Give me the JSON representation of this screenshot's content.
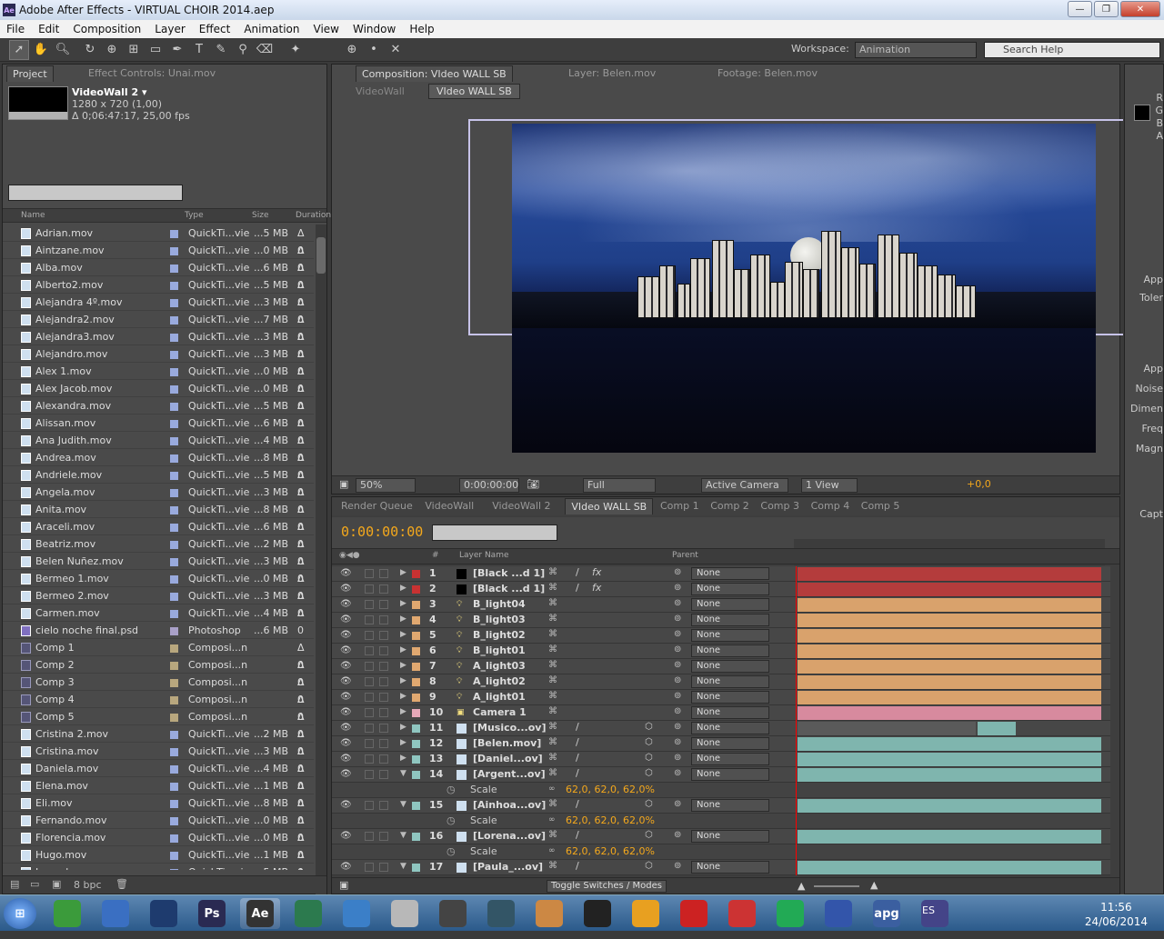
{
  "window": {
    "title": "Adobe After Effects - VIRTUAL CHOIR 2014.aep",
    "app_icon": "Ae"
  },
  "menu": [
    "File",
    "Edit",
    "Composition",
    "Layer",
    "Effect",
    "Animation",
    "View",
    "Window",
    "Help"
  ],
  "toolbar": {
    "workspace_label": "Workspace:",
    "workspace_value": "Animation",
    "search_placeholder": "Search Help"
  },
  "project_panel": {
    "tabs": [
      "Project",
      "Effect Controls: Unai.mov"
    ],
    "comp_name": "VideoWall 2 ▾",
    "comp_res": "1280 x 720 (1,00)",
    "comp_dur": "Δ 0;06:47:17, 25,00 fps",
    "columns": {
      "name": "Name",
      "type": "Type",
      "size": "Size",
      "duration": "Duration"
    },
    "bpc": "8 bpc",
    "files": [
      {
        "name": "Adrian.mov",
        "type": "QuickTi...vie",
        "size": "...5 MB",
        "dur": "Δ 0",
        "kind": "mov"
      },
      {
        "name": "Aintzane.mov",
        "type": "QuickTi...vie",
        "size": "...0 MB",
        "dur": "Δ 0",
        "kind": "mov"
      },
      {
        "name": "Alba.mov",
        "type": "QuickTi...vie",
        "size": "...6 MB",
        "dur": "Δ 0",
        "kind": "mov"
      },
      {
        "name": "Alberto2.mov",
        "type": "QuickTi...vie",
        "size": "...5 MB",
        "dur": "Δ 0",
        "kind": "mov"
      },
      {
        "name": "Alejandra 4º.mov",
        "type": "QuickTi...vie",
        "size": "...3 MB",
        "dur": "Δ 0",
        "kind": "mov"
      },
      {
        "name": "Alejandra2.mov",
        "type": "QuickTi...vie",
        "size": "...7 MB",
        "dur": "Δ 0",
        "kind": "mov"
      },
      {
        "name": "Alejandra3.mov",
        "type": "QuickTi...vie",
        "size": "...3 MB",
        "dur": "Δ 0",
        "kind": "mov"
      },
      {
        "name": "Alejandro.mov",
        "type": "QuickTi...vie",
        "size": "...3 MB",
        "dur": "Δ 0",
        "kind": "mov"
      },
      {
        "name": "Alex 1.mov",
        "type": "QuickTi...vie",
        "size": "...0 MB",
        "dur": "Δ 0",
        "kind": "mov"
      },
      {
        "name": "Alex Jacob.mov",
        "type": "QuickTi...vie",
        "size": "...0 MB",
        "dur": "Δ 0",
        "kind": "mov"
      },
      {
        "name": "Alexandra.mov",
        "type": "QuickTi...vie",
        "size": "...5 MB",
        "dur": "Δ 0",
        "kind": "mov"
      },
      {
        "name": "Alissan.mov",
        "type": "QuickTi...vie",
        "size": "...6 MB",
        "dur": "Δ 0",
        "kind": "mov"
      },
      {
        "name": "Ana Judith.mov",
        "type": "QuickTi...vie",
        "size": "...4 MB",
        "dur": "Δ 0",
        "kind": "mov"
      },
      {
        "name": "Andrea.mov",
        "type": "QuickTi...vie",
        "size": "...8 MB",
        "dur": "Δ 0",
        "kind": "mov"
      },
      {
        "name": "Andriele.mov",
        "type": "QuickTi...vie",
        "size": "...5 MB",
        "dur": "Δ 0",
        "kind": "mov"
      },
      {
        "name": "Angela.mov",
        "type": "QuickTi...vie",
        "size": "...3 MB",
        "dur": "Δ 0",
        "kind": "mov"
      },
      {
        "name": "Anita.mov",
        "type": "QuickTi...vie",
        "size": "...8 MB",
        "dur": "Δ 0",
        "kind": "mov"
      },
      {
        "name": "Araceli.mov",
        "type": "QuickTi...vie",
        "size": "...6 MB",
        "dur": "Δ 0",
        "kind": "mov"
      },
      {
        "name": "Beatriz.mov",
        "type": "QuickTi...vie",
        "size": "...2 MB",
        "dur": "Δ 0",
        "kind": "mov"
      },
      {
        "name": "Belen Nuñez.mov",
        "type": "QuickTi...vie",
        "size": "...3 MB",
        "dur": "Δ 0",
        "kind": "mov"
      },
      {
        "name": "Bermeo 1.mov",
        "type": "QuickTi...vie",
        "size": "...0 MB",
        "dur": "Δ 0",
        "kind": "mov"
      },
      {
        "name": "Bermeo 2.mov",
        "type": "QuickTi...vie",
        "size": "...3 MB",
        "dur": "Δ 0",
        "kind": "mov"
      },
      {
        "name": "Carmen.mov",
        "type": "QuickTi...vie",
        "size": "...4 MB",
        "dur": "Δ 0",
        "kind": "mov"
      },
      {
        "name": "cielo noche final.psd",
        "type": "Photoshop",
        "size": "...6 MB",
        "dur": "",
        "kind": "ps"
      },
      {
        "name": "Comp 1",
        "type": "Composi...n",
        "size": "",
        "dur": "Δ 0",
        "kind": "cp"
      },
      {
        "name": "Comp 2",
        "type": "Composi...n",
        "size": "",
        "dur": "Δ 0",
        "kind": "cp"
      },
      {
        "name": "Comp 3",
        "type": "Composi...n",
        "size": "",
        "dur": "Δ 0",
        "kind": "cp"
      },
      {
        "name": "Comp 4",
        "type": "Composi...n",
        "size": "",
        "dur": "Δ 0",
        "kind": "cp"
      },
      {
        "name": "Comp 5",
        "type": "Composi...n",
        "size": "",
        "dur": "Δ 0",
        "kind": "cp"
      },
      {
        "name": "Cristina 2.mov",
        "type": "QuickTi...vie",
        "size": "...2 MB",
        "dur": "Δ 0",
        "kind": "mov"
      },
      {
        "name": "Cristina.mov",
        "type": "QuickTi...vie",
        "size": "...3 MB",
        "dur": "Δ 0",
        "kind": "mov"
      },
      {
        "name": "Daniela.mov",
        "type": "QuickTi...vie",
        "size": "...4 MB",
        "dur": "Δ 0",
        "kind": "mov"
      },
      {
        "name": "Elena.mov",
        "type": "QuickTi...vie",
        "size": "...1 MB",
        "dur": "Δ 0",
        "kind": "mov"
      },
      {
        "name": "Eli.mov",
        "type": "QuickTi...vie",
        "size": "...8 MB",
        "dur": "Δ 0",
        "kind": "mov"
      },
      {
        "name": "Fernando.mov",
        "type": "QuickTi...vie",
        "size": "...0 MB",
        "dur": "Δ 0",
        "kind": "mov"
      },
      {
        "name": "Florencia.mov",
        "type": "QuickTi...vie",
        "size": "...0 MB",
        "dur": "Δ 0",
        "kind": "mov"
      },
      {
        "name": "Hugo.mov",
        "type": "QuickTi...vie",
        "size": "...1 MB",
        "dur": "Δ 0",
        "kind": "mov"
      },
      {
        "name": "Ismael.mov",
        "type": "QuickTi...vie",
        "size": "...5 MB",
        "dur": "Δ 0",
        "kind": "mov"
      }
    ]
  },
  "comp_panel": {
    "tabs": [
      "Composition: VIdeo WALL SB",
      "Layer: Belen.mov",
      "Footage: Belen.mov"
    ],
    "breadcrumbs": [
      "VideoWall",
      "VIdeo WALL SB"
    ],
    "zoom": "50%",
    "timecode": "0:00:00:00",
    "resolution": "Full",
    "camera": "Active Camera",
    "views": "1 View",
    "exposure": "+0,0"
  },
  "timeline": {
    "tabs": [
      "Render Queue",
      "VideoWall",
      "VideoWall 2",
      "VIdeo WALL SB",
      "Comp 1",
      "Comp 2",
      "Comp 3",
      "Comp 4",
      "Comp 5"
    ],
    "active_tab": 3,
    "timecode": "0:00:00:00",
    "ruler": [
      "0m",
      "01m",
      "02m",
      "03m",
      "04m"
    ],
    "col_layer_name": "Layer Name",
    "col_num": "#",
    "col_parent": "Parent",
    "toggle_label": "Toggle Switches / Modes",
    "layers": [
      {
        "num": "1",
        "name": "[Black ...d 1]",
        "label_color": "#c83232",
        "bar": "#b43c3c",
        "sub": false,
        "icon": "solid"
      },
      {
        "num": "2",
        "name": "[Black ...d 1]",
        "label_color": "#c83232",
        "bar": "#b43c3c",
        "sub": false,
        "icon": "solid"
      },
      {
        "num": "3",
        "name": "B_light04",
        "label_color": "#e0a870",
        "bar": "#d9a26c",
        "sub": false,
        "icon": "light"
      },
      {
        "num": "4",
        "name": "B_light03",
        "label_color": "#e0a870",
        "bar": "#d9a26c",
        "sub": false,
        "icon": "light"
      },
      {
        "num": "5",
        "name": "B_light02",
        "label_color": "#e0a870",
        "bar": "#d9a26c",
        "sub": false,
        "icon": "light"
      },
      {
        "num": "6",
        "name": "B_light01",
        "label_color": "#e0a870",
        "bar": "#d9a26c",
        "sub": false,
        "icon": "light"
      },
      {
        "num": "7",
        "name": "A_light03",
        "label_color": "#e0a870",
        "bar": "#d9a26c",
        "sub": false,
        "icon": "light"
      },
      {
        "num": "8",
        "name": "A_light02",
        "label_color": "#e0a870",
        "bar": "#d9a26c",
        "sub": false,
        "icon": "light"
      },
      {
        "num": "9",
        "name": "A_light01",
        "label_color": "#e0a870",
        "bar": "#d9a26c",
        "sub": false,
        "icon": "light"
      },
      {
        "num": "10",
        "name": "Camera 1",
        "label_color": "#e6a8b8",
        "bar": "#d78a9e",
        "sub": false,
        "icon": "camera"
      },
      {
        "num": "11",
        "name": "[Musico...ov]",
        "label_color": "#8fc6c0",
        "bar": "#7fb5ae",
        "sub": false,
        "icon": "footage",
        "short": true
      },
      {
        "num": "12",
        "name": "[Belen.mov]",
        "label_color": "#8fc6c0",
        "bar": "#7fb5ae",
        "sub": false,
        "icon": "footage"
      },
      {
        "num": "13",
        "name": "[Daniel...ov]",
        "label_color": "#8fc6c0",
        "bar": "#7fb5ae",
        "sub": false,
        "icon": "footage"
      },
      {
        "num": "14",
        "name": "[Argent...ov]",
        "label_color": "#8fc6c0",
        "bar": "#7fb5ae",
        "sub": false,
        "icon": "footage",
        "open": true
      },
      {
        "sub": true,
        "name": "Scale",
        "value": "62,0, 62,0, 62,0%"
      },
      {
        "num": "15",
        "name": "[Ainhoa...ov]",
        "label_color": "#8fc6c0",
        "bar": "#7fb5ae",
        "sub": false,
        "icon": "footage",
        "open": true
      },
      {
        "sub": true,
        "name": "Scale",
        "value": "62,0, 62,0, 62,0%"
      },
      {
        "num": "16",
        "name": "[Lorena...ov]",
        "label_color": "#8fc6c0",
        "bar": "#7fb5ae",
        "sub": false,
        "icon": "footage",
        "open": true
      },
      {
        "sub": true,
        "name": "Scale",
        "value": "62,0, 62,0, 62,0%"
      },
      {
        "num": "17",
        "name": "[Paula_...ov]",
        "label_color": "#8fc6c0",
        "bar": "#7fb5ae",
        "sub": false,
        "icon": "footage",
        "open": true
      }
    ],
    "parent_default": "None"
  },
  "right_panel": {
    "labels": [
      "R",
      "G",
      "B",
      "A",
      "App",
      "Toler",
      "App",
      "Noise",
      "Dimen",
      "Freq",
      "Magn",
      "Capt"
    ]
  },
  "taskbar": {
    "apps": [
      "",
      "",
      "",
      "Ps",
      "Ae",
      "",
      "",
      "",
      "",
      "",
      "",
      "",
      "",
      "",
      "",
      "",
      "",
      "apg",
      ""
    ],
    "lang": "ES",
    "time": "11:56",
    "date": "24/06/2014"
  }
}
